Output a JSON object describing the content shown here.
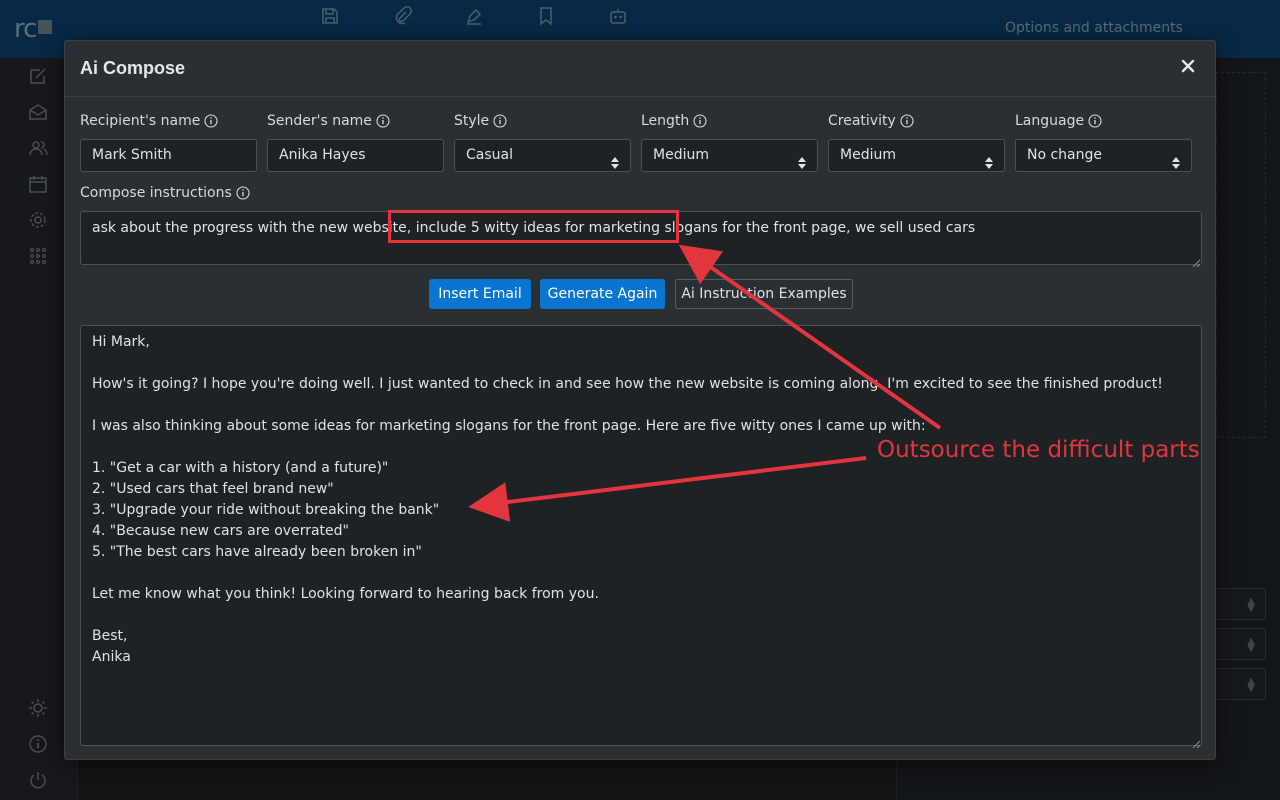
{
  "app": {
    "logo_text": "rc"
  },
  "background": {
    "options_title": "Options and attachments"
  },
  "modal": {
    "title": "Ai Compose",
    "close_icon": "close-icon"
  },
  "fields": {
    "recipient": {
      "label": "Recipient's name",
      "value": "Mark Smith"
    },
    "sender": {
      "label": "Sender's name",
      "value": "Anika Hayes"
    },
    "style": {
      "label": "Style",
      "value": "Casual"
    },
    "length": {
      "label": "Length",
      "value": "Medium"
    },
    "creativity": {
      "label": "Creativity",
      "value": "Medium"
    },
    "language": {
      "label": "Language",
      "value": "No change"
    }
  },
  "instructions": {
    "label": "Compose instructions",
    "value": "ask about the progress with the new website, include 5 witty ideas for marketing slogans for the front page, we sell used cars"
  },
  "buttons": {
    "insert": "Insert Email",
    "generate": "Generate Again",
    "examples": "Ai Instruction Examples"
  },
  "email": {
    "lines": [
      "Hi Mark,",
      "",
      "How's it going? I hope you're doing well. I just wanted to check in and see how the new website is coming along. I'm excited to see the finished product!",
      "",
      "I was also thinking about some ideas for marketing slogans for the front page. Here are five witty ones I came up with:",
      "",
      "1. \"Get a car with a history (and a future)\"",
      "2. \"Used cars that feel brand new\"",
      "3. \"Upgrade your ride without breaking the bank\"",
      "4. \"Because new cars are overrated\"",
      "5. \"The best cars have already been broken in\"",
      "",
      "Let me know what you think! Looking forward to hearing back from you.",
      "",
      "Best,",
      "Anika"
    ]
  },
  "annotation": {
    "text": "Outsource the difficult parts",
    "color": "#e2353d"
  },
  "colors": {
    "primary": "#0a74d1",
    "topbar": "#0b3f6e"
  }
}
